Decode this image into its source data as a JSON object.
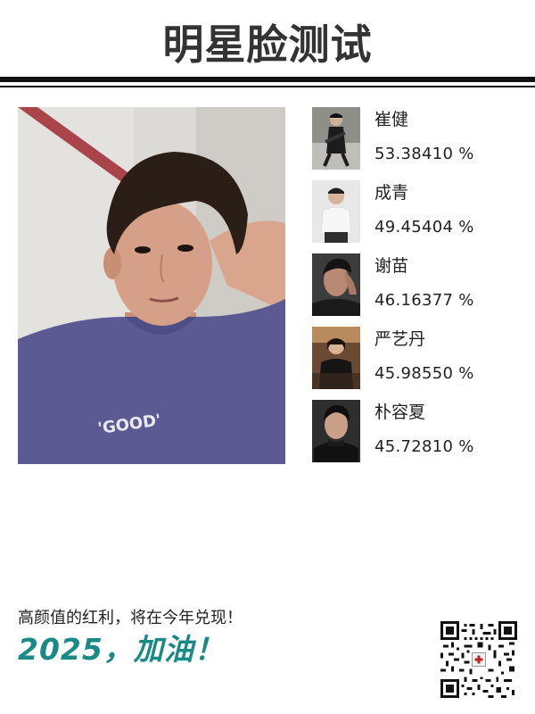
{
  "header": {
    "title": "明星脸测试"
  },
  "matches": [
    {
      "name": "崔健",
      "score": "53.38410 %"
    },
    {
      "name": "成青",
      "score": "49.45404 %"
    },
    {
      "name": "谢苗",
      "score": "46.16377 %"
    },
    {
      "name": "严艺丹",
      "score": "45.98550 %"
    },
    {
      "name": "朴容夏",
      "score": "45.72810 %"
    }
  ],
  "photo": {
    "shirt_text": "'GOOD'"
  },
  "footer": {
    "slogan": "高颜值的红利，将在今年兑现！",
    "cheer": "2025，加油！"
  },
  "colors": {
    "accent": "#1a8a87",
    "title": "#333333",
    "rule": "#111111"
  },
  "icons": {
    "qr": "qr-code-icon"
  }
}
